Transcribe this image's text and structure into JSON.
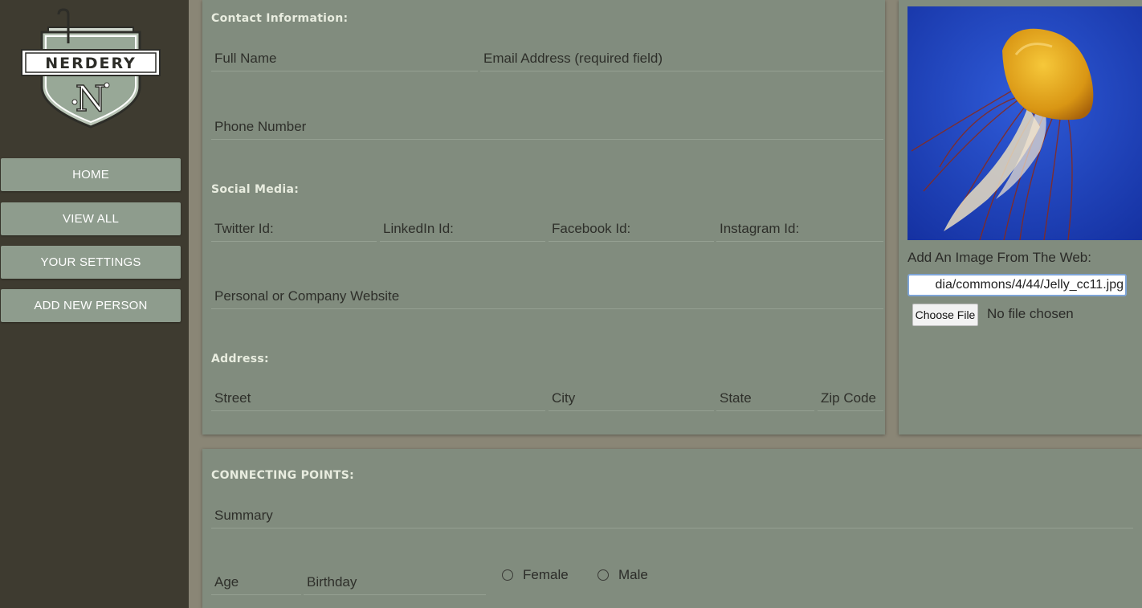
{
  "logo": {
    "text": "NERDERY",
    "letter": "N"
  },
  "nav": {
    "home": "HOME",
    "view_all": "VIEW ALL",
    "settings": "YOUR SETTINGS",
    "add_person": "ADD NEW PERSON"
  },
  "contact": {
    "title": "Contact Information:",
    "full_name": "Full Name",
    "email": "Email Address (required field)",
    "phone": "Phone Number"
  },
  "social": {
    "title": "Social Media:",
    "twitter": "Twitter Id:",
    "linkedin": "LinkedIn Id:",
    "facebook": "Facebook Id:",
    "instagram": "Instagram Id:",
    "website": "Personal or Company Website"
  },
  "address": {
    "title": "Address:",
    "street": "Street",
    "city": "City",
    "state": "State",
    "zip": "Zip Code"
  },
  "image": {
    "web_label": "Add An Image From The Web:",
    "web_value": "dia/commons/4/44/Jelly_cc11.jpg",
    "choose_file": "Choose File",
    "no_file": "No file chosen"
  },
  "connecting": {
    "title": "CONNECTING POINTS:",
    "summary": "Summary",
    "age": "Age",
    "birthday": "Birthday",
    "female": "Female",
    "male": "Male"
  },
  "colors": {
    "sidebar": "#3e3b30",
    "nav_button": "#8e9c8d",
    "panel": "#818c7e",
    "photo_bg": "#1d3fb8",
    "jelly": "#e0a21a"
  }
}
